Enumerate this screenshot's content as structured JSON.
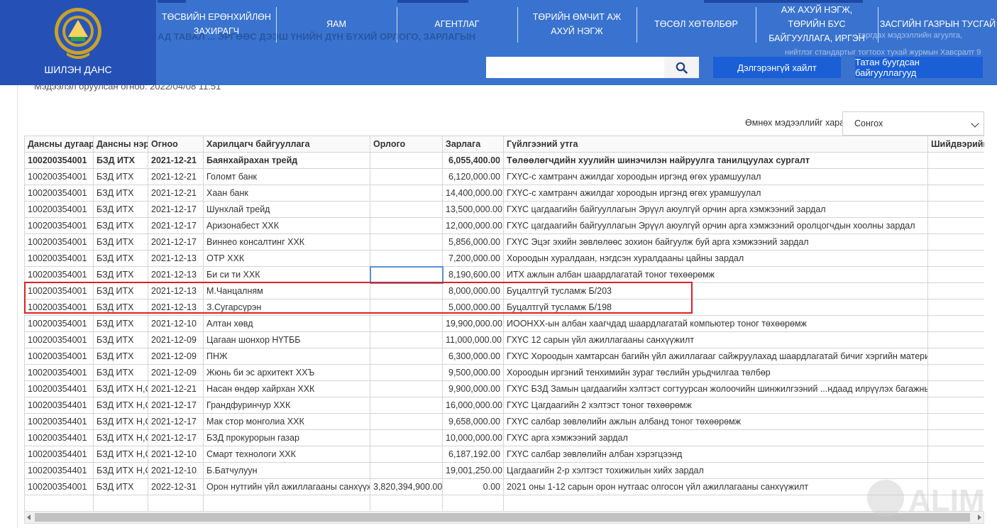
{
  "site": {
    "title": "ШИЛЭН ДАНС"
  },
  "nav": [
    {
      "label": "ТӨСВИЙН ЕРӨНХИЙЛӨН ЗАХИРАГЧ"
    },
    {
      "label": "ЯАМ"
    },
    {
      "label": "АГЕНТЛАГ"
    },
    {
      "label": "ТӨРИЙН ӨМЧИТ АЖ АХУЙ НЭГЖ"
    },
    {
      "label": "ТӨСӨЛ ХӨТӨЛБӨР"
    },
    {
      "label": "АЖ АХУЙ НЭГЖ, ТӨРИЙН БУС БАЙГУУЛЛАГА, ИРГЭН"
    },
    {
      "label": "ЗАСГИЙН ГАЗРЫН ТУСГАЙ"
    }
  ],
  "behind_header": {
    "heading": "АД ТАВАЛ ... ЭРГӨӨС ДЭЭШ ҮНИЙН ДҮН БҮХИЙ ОРЛОГО, ЗАРЛАГЫН",
    "note1": "...таргдах мэдээллийн агуулга,",
    "note2": "нийтлэг стандартыг тогтоох тухай журмын Хавсралт 9"
  },
  "search": {
    "placeholder": "",
    "value": ""
  },
  "buttons": {
    "advanced_search": "Дэлгэрэнгүй хайлт",
    "funded_orgs": "Татан буугдсан байгууллагууд"
  },
  "updated_text": "Мэдээлэл оруулсан огноо: 2022/04/08 11:51",
  "previous": {
    "label": "Өмнөх мэдээллийг харах",
    "selected": "Сонгох"
  },
  "table": {
    "headers": [
      "Дансны дугаар",
      "Дансны нэр",
      "Огноо",
      "Харилцагч байгууллага",
      "Орлого",
      "Зарлага",
      "Гүйлгээний утга",
      "Шийдвэрийн х"
    ],
    "rows": [
      [
        "100200354001",
        "БЗД ИТХ",
        "2021-12-21",
        "Баянхайрахан трейд",
        "",
        "6,055,400.00",
        "Төлөөлөгчдийн хуулийн шинэчилэн найруулга танилцуулах сургалт",
        ""
      ],
      [
        "100200354001",
        "БЗД ИТХ",
        "2021-12-21",
        "Голомт банк",
        "",
        "6,120,000.00",
        "ГХҮС-с хамтранч ажилдаг хороодын иргэнд өгөх урамшуулал",
        ""
      ],
      [
        "100200354001",
        "БЗД ИТХ",
        "2021-12-21",
        "Хаан банк",
        "",
        "14,400,000.00",
        "ГХҮС-с хамтранч ажилдаг хороодын иргэнд өгөх урамшуулал",
        ""
      ],
      [
        "100200354001",
        "БЗД ИТХ",
        "2021-12-17",
        "Шунхлай трейд",
        "",
        "13,500,000.00",
        "ГХҮС цагдаагийн байгууллагын Эрүүл аюулгүй орчин арга хэмжээний зардал",
        ""
      ],
      [
        "100200354001",
        "БЗД ИТХ",
        "2021-12-17",
        "Аризонабест ХХК",
        "",
        "12,000,000.00",
        "ГХҮС цагдаагийн байгууллагын Эрүүл аюулгүй орчин арга хэмжээний оролцогчдын хоолны зардал",
        ""
      ],
      [
        "100200354001",
        "БЗД ИТХ",
        "2021-12-17",
        "Виннео консалтинг ХХК",
        "",
        "5,856,000.00",
        "ГХҮС Эцэг эхийн зөвлөлөөс зохион байгуулж буй арга хэмжээний зардал",
        ""
      ],
      [
        "100200354001",
        "БЗД ИТХ",
        "2021-12-13",
        "ОТР ХХК",
        "",
        "7,200,000.00",
        "Хороодын хуралдаан, нэгдсэн хуралдааны цайны зардал",
        ""
      ],
      [
        "100200354001",
        "БЗД ИТХ",
        "2021-12-13",
        "Би си ти ХХК",
        "",
        "8,190,600.00",
        "ИТХ ажлын албан шаардлагатай тоног төхөөрөмж",
        ""
      ],
      [
        "100200354001",
        "БЗД ИТХ",
        "2021-12-13",
        "М.Чанцалням",
        "",
        "8,000,000.00",
        "Буцалтгүй тусламж Б/203",
        ""
      ],
      [
        "100200354001",
        "БЗД ИТХ",
        "2021-12-13",
        "З.Сугарсүрэн",
        "",
        "5,000,000.00",
        "Буцалтгүй тусламж Б/198",
        ""
      ],
      [
        "100200354001",
        "БЗД ИТХ",
        "2021-12-10",
        "Алтан хөвд",
        "",
        "19,900,000.00",
        "ИООНХХ-ын албан хаагчдад шаардлагатай компьютер тоног төхөөрөмж",
        ""
      ],
      [
        "100200354001",
        "БЗД ИТХ",
        "2021-12-09",
        "Цагаан шонхор НҮТББ",
        "",
        "11,000,000.00",
        "ГХҮС 12 сарын үйл ажиллагааны санхүүжилт",
        ""
      ],
      [
        "100200354001",
        "БЗД ИТХ",
        "2021-12-09",
        "ПНЖ",
        "",
        "6,300,000.00",
        "ГХҮС Хороодын хамтарсан багийн үйл ажиллагааг сайжруулахад шаардлагатай бичиг хэргийн материалын үнэ",
        ""
      ],
      [
        "100200354001",
        "БЗД ИТХ",
        "2021-12-09",
        "Жюнь би эс архитект ХХЪ",
        "",
        "9,500,000.00",
        "Хороодын иргэний тенхимийн зураг төслийн урьдчилгаа төлбөр",
        ""
      ],
      [
        "100200354401",
        "БЗД ИТХ Н,С",
        "2021-12-21",
        "Насан өндөр хайрхан ХХК",
        "",
        "9,900,000.00",
        "ГХҮС БЗД Замын цагдаагийн хэлтэст согтуурсан жолоочийн шинжилгээний ...ндаад илрүүлэх багажны үнэ",
        ""
      ],
      [
        "100200354401",
        "БЗД ИТХ Н,С",
        "2021-12-17",
        "Грандфуринчур ХХК",
        "",
        "16,000,000.00",
        "ГХҮС Цагдаагийн 2 хэлтэст тоног төхөөрөмж",
        ""
      ],
      [
        "100200354401",
        "БЗД ИТХ Н,С",
        "2021-12-17",
        "Мак стор монголиа ХХК",
        "",
        "9,658,000.00",
        "ГХҮС салбар зөвлөлийн ажлын албанд тоног төхөөрөмж",
        ""
      ],
      [
        "100200354401",
        "БЗД ИТХ Н,С",
        "2021-12-17",
        "БЗД прокурорын газар",
        "",
        "10,000,000.00",
        "ГХҮС арга хэмжээний зардал",
        ""
      ],
      [
        "100200354401",
        "БЗД ИТХ Н,С",
        "2021-12-10",
        "Смарт технологи ХХК",
        "",
        "6,187,192.00",
        "ГХҮС салбар зөвлөлийн албан хэрэгцээнд",
        ""
      ],
      [
        "100200354401",
        "БЗД ИТХ Н,С",
        "2021-12-10",
        "Б.Батчулуун",
        "",
        "19,001,250.00",
        "Цагдаагийн 2-р хэлтэст тохижилын хийх зардал",
        ""
      ],
      [
        "100200354001",
        "БЗД ИТХ",
        "2022-12-31",
        "Орон нутгийн үйл ажиллагааны санхүүжилт",
        "3,820,394,900.00",
        "0.00",
        "2021 оны 1-12 сарын орон нутгаас олгосон үйл ажиллагааны санхүүжилт",
        ""
      ],
      [
        "",
        "",
        "",
        "",
        "",
        "",
        "",
        ""
      ]
    ]
  },
  "colors": {
    "header_blue": "#3a73cf",
    "logo_blue": "#2551b7",
    "button_blue": "#1a5fd6",
    "highlight_red": "#e02020"
  },
  "icons": {
    "search": "magnifier-icon",
    "select": "chevron-down-icon",
    "emblem": "state-emblem-icon"
  },
  "watermark": "ALIM"
}
